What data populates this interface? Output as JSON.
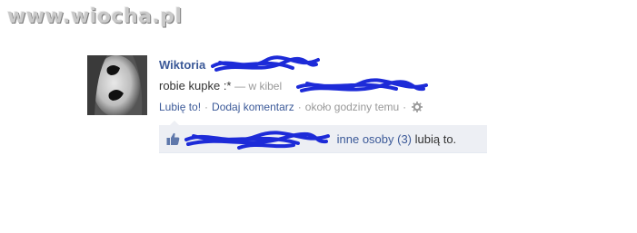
{
  "watermark": "www.wiocha.pl",
  "post": {
    "author_visible": "Wiktoria",
    "status_text": "robie kupke :*",
    "location_prefix": "— w kibel",
    "actions": {
      "like": "Lubię to!",
      "comment": "Dodaj komentarz",
      "time": "około godziny temu"
    },
    "likes": {
      "others_link": "inne osoby (3)",
      "suffix": "lubią to."
    }
  },
  "colors": {
    "link": "#3b5998",
    "likes_bg": "#edeff4",
    "scribble": "#1d2bd8"
  },
  "icons": [
    "thumbs-up-icon",
    "gear-icon"
  ]
}
